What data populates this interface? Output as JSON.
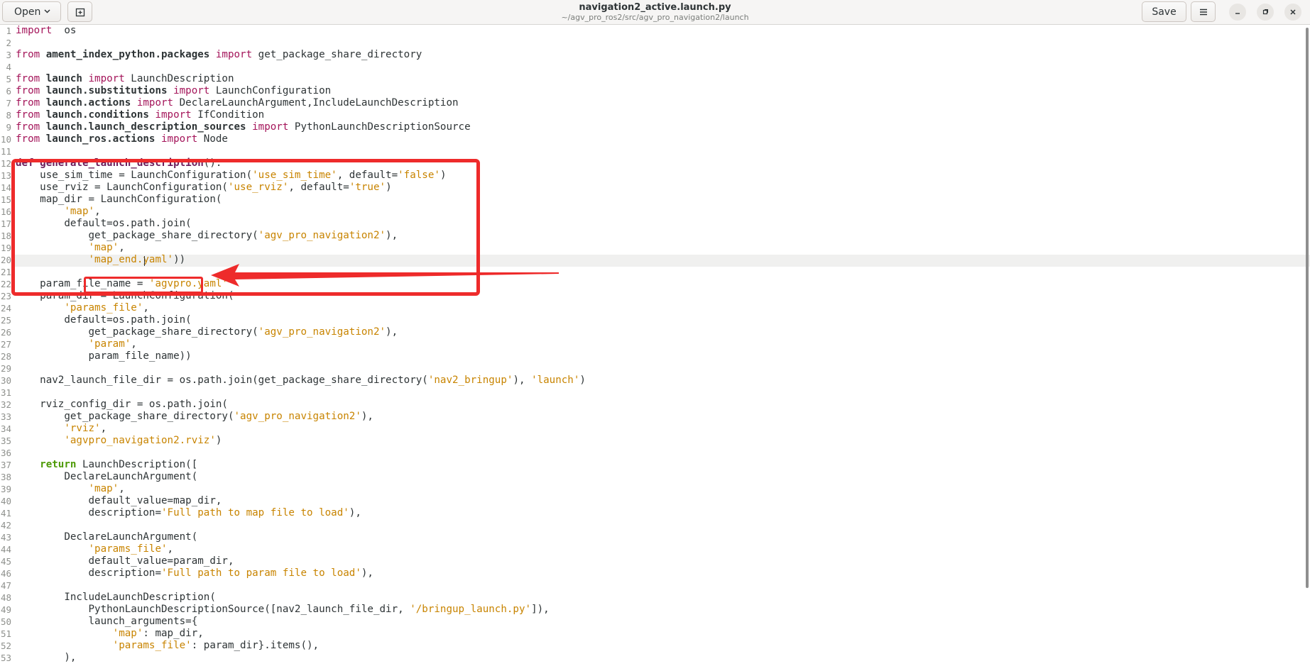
{
  "header": {
    "open_label": "Open",
    "save_label": "Save",
    "title": "navigation2_active.launch.py",
    "subtitle": "~/agv_pro_ros2/src/agv_pro_navigation2/launch"
  },
  "icons": {
    "open_dropdown": "chevron-down-icon",
    "new_tab": "new-tab-icon",
    "menu": "hamburger-menu-icon",
    "minimize": "minimize-icon",
    "maximize": "maximize-icon",
    "close": "close-icon"
  },
  "colors": {
    "annotation": "#ee2b2b",
    "keyword": "#a4155a",
    "string": "#c88400",
    "return_keyword": "#4e9a06"
  },
  "editor": {
    "current_line": 20,
    "lines": [
      {
        "n": "1",
        "t": [
          [
            "kw",
            "import"
          ],
          [
            "",
            "  os"
          ]
        ]
      },
      {
        "n": "2",
        "t": []
      },
      {
        "n": "3",
        "t": [
          [
            "kw",
            "from"
          ],
          [
            "",
            ""
          ],
          [
            "mod",
            " ament_index_python.packages "
          ],
          [
            "kw",
            "import"
          ],
          [
            "",
            " get_package_share_directory"
          ]
        ]
      },
      {
        "n": "4",
        "t": []
      },
      {
        "n": "5",
        "t": [
          [
            "kw",
            "from"
          ],
          [
            "mod",
            " launch "
          ],
          [
            "kw",
            "import"
          ],
          [
            "",
            " LaunchDescription"
          ]
        ]
      },
      {
        "n": "6",
        "t": [
          [
            "kw",
            "from"
          ],
          [
            "mod",
            " launch.substitutions "
          ],
          [
            "kw",
            "import"
          ],
          [
            "",
            " LaunchConfiguration"
          ]
        ]
      },
      {
        "n": "7",
        "t": [
          [
            "kw",
            "from"
          ],
          [
            "mod",
            " launch.actions "
          ],
          [
            "kw",
            "import"
          ],
          [
            "",
            " DeclareLaunchArgument,IncludeLaunchDescription"
          ]
        ]
      },
      {
        "n": "8",
        "t": [
          [
            "kw",
            "from"
          ],
          [
            "mod",
            " launch.conditions "
          ],
          [
            "kw",
            "import"
          ],
          [
            "",
            " IfCondition"
          ]
        ]
      },
      {
        "n": "9",
        "t": [
          [
            "kw",
            "from"
          ],
          [
            "mod",
            " launch.launch_description_sources "
          ],
          [
            "kw",
            "import"
          ],
          [
            "",
            " PythonLaunchDescriptionSource"
          ]
        ]
      },
      {
        "n": "10",
        "t": [
          [
            "kw",
            "from"
          ],
          [
            "mod",
            " launch_ros.actions "
          ],
          [
            "kw",
            "import"
          ],
          [
            "",
            " Node"
          ]
        ]
      },
      {
        "n": "11",
        "t": []
      },
      {
        "n": "12",
        "t": [
          [
            "fn",
            "def"
          ],
          [
            "",
            " "
          ],
          [
            "fn",
            "generate_launch_description"
          ],
          [
            "",
            "():"
          ]
        ]
      },
      {
        "n": "13",
        "t": [
          [
            "",
            "    use_sim_time = LaunchConfiguration("
          ],
          [
            "str",
            "'use_sim_time'"
          ],
          [
            "",
            ", default="
          ],
          [
            "str",
            "'false'"
          ],
          [
            "",
            ")"
          ]
        ]
      },
      {
        "n": "14",
        "t": [
          [
            "",
            "    use_rviz = LaunchConfiguration("
          ],
          [
            "str",
            "'use_rviz'"
          ],
          [
            "",
            ", default="
          ],
          [
            "str",
            "'true'"
          ],
          [
            "",
            ")"
          ]
        ]
      },
      {
        "n": "15",
        "t": [
          [
            "",
            "    map_dir = LaunchConfiguration("
          ]
        ]
      },
      {
        "n": "16",
        "t": [
          [
            "",
            "        "
          ],
          [
            "str",
            "'map'"
          ],
          [
            "",
            ","
          ]
        ]
      },
      {
        "n": "17",
        "t": [
          [
            "",
            "        default=os.path.join("
          ]
        ]
      },
      {
        "n": "18",
        "t": [
          [
            "",
            "            get_package_share_directory("
          ],
          [
            "str",
            "'agv_pro_navigation2'"
          ],
          [
            "",
            "),"
          ]
        ]
      },
      {
        "n": "19",
        "t": [
          [
            "",
            "            "
          ],
          [
            "str",
            "'map'"
          ],
          [
            "",
            ","
          ]
        ]
      },
      {
        "n": "20",
        "t": [
          [
            "",
            "            "
          ],
          [
            "str",
            "'map_end.yaml'"
          ],
          [
            "",
            "))"
          ]
        ]
      },
      {
        "n": "21",
        "t": []
      },
      {
        "n": "22",
        "t": [
          [
            "",
            "    param_file_name = "
          ],
          [
            "str",
            "'agvpro.yaml'"
          ]
        ]
      },
      {
        "n": "23",
        "t": [
          [
            "",
            "    param_dir = LaunchConfiguration("
          ]
        ]
      },
      {
        "n": "24",
        "t": [
          [
            "",
            "        "
          ],
          [
            "str",
            "'params_file'"
          ],
          [
            "",
            ","
          ]
        ]
      },
      {
        "n": "25",
        "t": [
          [
            "",
            "        default=os.path.join("
          ]
        ]
      },
      {
        "n": "26",
        "t": [
          [
            "",
            "            get_package_share_directory("
          ],
          [
            "str",
            "'agv_pro_navigation2'"
          ],
          [
            "",
            "),"
          ]
        ]
      },
      {
        "n": "27",
        "t": [
          [
            "",
            "            "
          ],
          [
            "str",
            "'param'"
          ],
          [
            "",
            ","
          ]
        ]
      },
      {
        "n": "28",
        "t": [
          [
            "",
            "            param_file_name))"
          ]
        ]
      },
      {
        "n": "29",
        "t": []
      },
      {
        "n": "30",
        "t": [
          [
            "",
            "    nav2_launch_file_dir = os.path.join(get_package_share_directory("
          ],
          [
            "str",
            "'nav2_bringup'"
          ],
          [
            "",
            "), "
          ],
          [
            "str",
            "'launch'"
          ],
          [
            "",
            ")"
          ]
        ]
      },
      {
        "n": "31",
        "t": []
      },
      {
        "n": "32",
        "t": [
          [
            "",
            "    rviz_config_dir = os.path.join("
          ]
        ]
      },
      {
        "n": "33",
        "t": [
          [
            "",
            "        get_package_share_directory("
          ],
          [
            "str",
            "'agv_pro_navigation2'"
          ],
          [
            "",
            "),"
          ]
        ]
      },
      {
        "n": "34",
        "t": [
          [
            "",
            "        "
          ],
          [
            "str",
            "'rviz'"
          ],
          [
            "",
            ","
          ]
        ]
      },
      {
        "n": "35",
        "t": [
          [
            "",
            "        "
          ],
          [
            "str",
            "'agvpro_navigation2.rviz'"
          ],
          [
            "",
            ")"
          ]
        ]
      },
      {
        "n": "36",
        "t": []
      },
      {
        "n": "37",
        "t": [
          [
            "",
            "    "
          ],
          [
            "ret",
            "return"
          ],
          [
            "",
            " LaunchDescription(["
          ]
        ]
      },
      {
        "n": "38",
        "t": [
          [
            "",
            "        DeclareLaunchArgument("
          ]
        ]
      },
      {
        "n": "39",
        "t": [
          [
            "",
            "            "
          ],
          [
            "str",
            "'map'"
          ],
          [
            "",
            ","
          ]
        ]
      },
      {
        "n": "40",
        "t": [
          [
            "",
            "            default_value=map_dir,"
          ]
        ]
      },
      {
        "n": "41",
        "t": [
          [
            "",
            "            description="
          ],
          [
            "str",
            "'Full path to map file to load'"
          ],
          [
            "",
            "),"
          ]
        ]
      },
      {
        "n": "42",
        "t": []
      },
      {
        "n": "43",
        "t": [
          [
            "",
            "        DeclareLaunchArgument("
          ]
        ]
      },
      {
        "n": "44",
        "t": [
          [
            "",
            "            "
          ],
          [
            "str",
            "'params_file'"
          ],
          [
            "",
            ","
          ]
        ]
      },
      {
        "n": "45",
        "t": [
          [
            "",
            "            default_value=param_dir,"
          ]
        ]
      },
      {
        "n": "46",
        "t": [
          [
            "",
            "            description="
          ],
          [
            "str",
            "'Full path to param file to load'"
          ],
          [
            "",
            "),"
          ]
        ]
      },
      {
        "n": "47",
        "t": []
      },
      {
        "n": "48",
        "t": [
          [
            "",
            "        IncludeLaunchDescription("
          ]
        ]
      },
      {
        "n": "49",
        "t": [
          [
            "",
            "            PythonLaunchDescriptionSource([nav2_launch_file_dir, "
          ],
          [
            "str",
            "'/bringup_launch.py'"
          ],
          [
            "",
            "]),"
          ]
        ]
      },
      {
        "n": "50",
        "t": [
          [
            "",
            "            launch_arguments={"
          ]
        ]
      },
      {
        "n": "51",
        "t": [
          [
            "",
            "                "
          ],
          [
            "str",
            "'map'"
          ],
          [
            "",
            ": map_dir,"
          ]
        ]
      },
      {
        "n": "52",
        "t": [
          [
            "",
            "                "
          ],
          [
            "str",
            "'params_file'"
          ],
          [
            "",
            ": param_dir}.items(),"
          ]
        ]
      },
      {
        "n": "53",
        "t": [
          [
            "",
            "        ),"
          ]
        ]
      }
    ]
  }
}
